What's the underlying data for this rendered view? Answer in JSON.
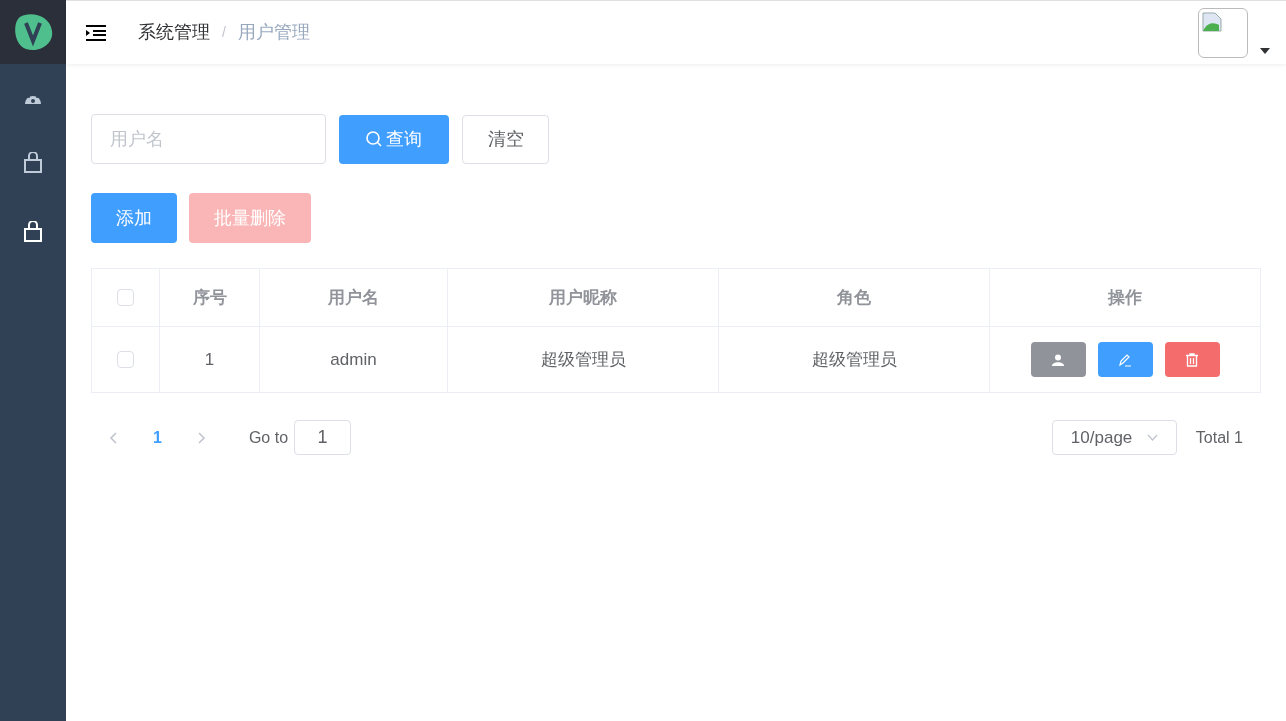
{
  "breadcrumb": [
    {
      "label": "系统管理",
      "current": false
    },
    {
      "label": "/",
      "kind": "separator"
    },
    {
      "label": "用户管理",
      "current": true
    }
  ],
  "search": {
    "placeholder": "用户名",
    "query_button": "查询",
    "clear_button": "清空"
  },
  "actions": [
    {
      "label": "添加",
      "kind": "primary",
      "disabled": false
    },
    {
      "label": "批量删除",
      "kind": "danger",
      "disabled": true
    }
  ],
  "table": {
    "select_all_checked": false,
    "columns": [
      "序号",
      "用户名",
      "用户昵称",
      "角色",
      "操作"
    ],
    "rows": [
      {
        "checked": false,
        "cells": [
          "1",
          "admin",
          "超级管理员",
          "超级管理员"
        ]
      }
    ]
  },
  "pagination": {
    "pages": [
      {
        "label": "1",
        "selected": true
      }
    ],
    "goto_label": "Go to",
    "goto_value": "1",
    "page_size": "10/page",
    "total": "Total 1"
  }
}
